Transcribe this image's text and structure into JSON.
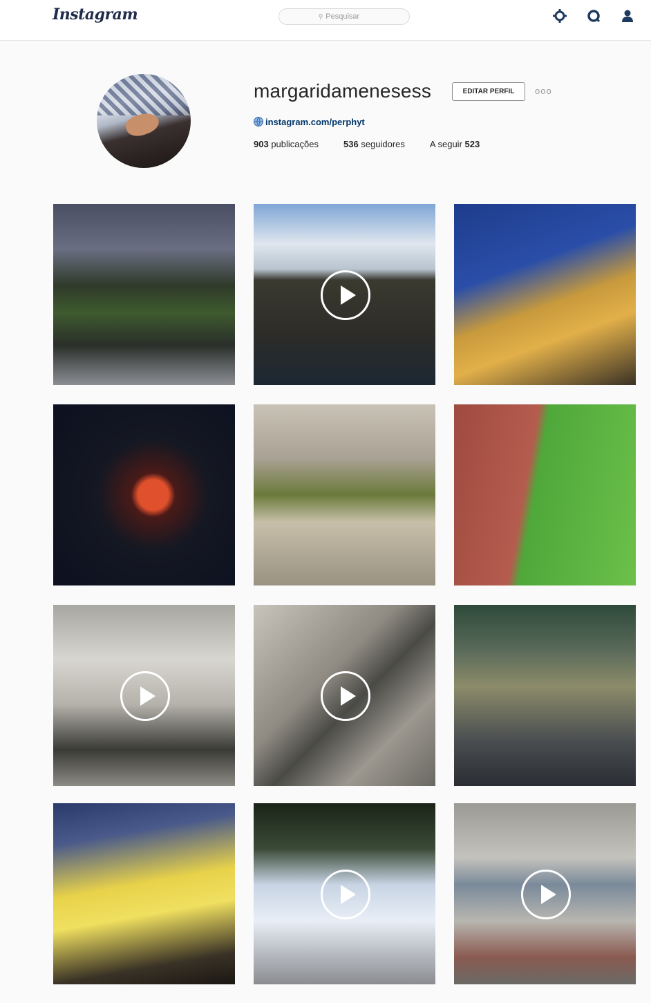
{
  "header": {
    "logo": "Instagram",
    "search_placeholder": "Pesquisar",
    "icons": [
      "explore-icon",
      "heart-icon",
      "person-icon"
    ]
  },
  "profile": {
    "username": "margaridamenesess",
    "edit_label": "EDITAR PERFIL",
    "more_label": "ooo",
    "website": "instagram.com/perphyt",
    "posts_count": "903",
    "posts_label": "publicações",
    "followers_count": "536",
    "followers_label": "seguidores",
    "following_label": "A seguir",
    "following_count": "523"
  },
  "posts": [
    {
      "video": false
    },
    {
      "video": true
    },
    {
      "video": false
    },
    {
      "video": false
    },
    {
      "video": false
    },
    {
      "video": false
    },
    {
      "video": true
    },
    {
      "video": true
    },
    {
      "video": false
    },
    {
      "video": false
    },
    {
      "video": true
    },
    {
      "video": true
    }
  ],
  "colors": {
    "accent": "#003569",
    "logo": "#1f2b4a",
    "icon": "#1f3a5f"
  }
}
